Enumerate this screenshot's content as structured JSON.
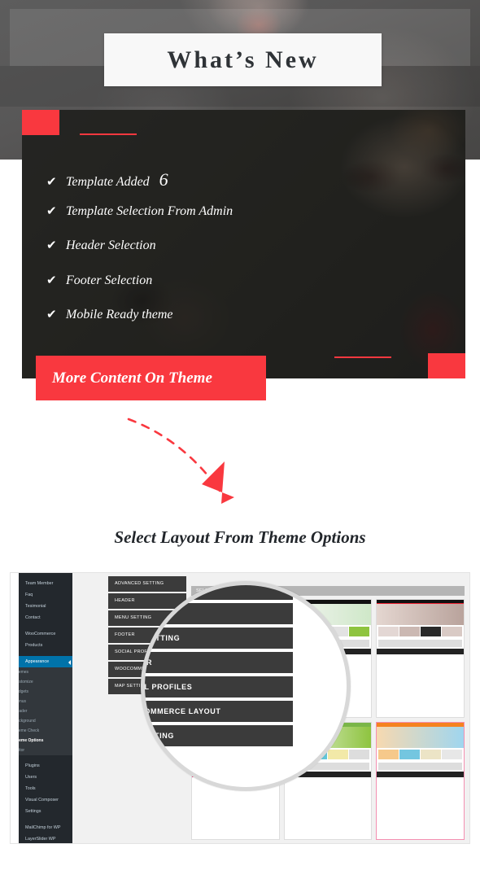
{
  "hero": {
    "title": "What’s New"
  },
  "feature_panel": {
    "items": [
      {
        "label": "Template Added",
        "count": "6"
      },
      {
        "label": "Template Selection From Admin",
        "count": ""
      },
      {
        "label": "Header Selection",
        "count": ""
      },
      {
        "label": "Footer Selection",
        "count": ""
      },
      {
        "label": "Mobile Ready theme",
        "count": ""
      }
    ],
    "check_icon": "✔",
    "accent_color": "#f9383f"
  },
  "cta": {
    "label": "More Content On Theme"
  },
  "section": {
    "heading": "Select Layout From Theme Options"
  },
  "screenshot": {
    "wp_sidebar": {
      "items": [
        {
          "label": "Team Member",
          "active": false
        },
        {
          "label": "Faq",
          "active": false
        },
        {
          "label": "Tesimonial",
          "active": false
        },
        {
          "label": "Contact",
          "active": false
        },
        {
          "label": "WooCommerce",
          "active": false
        },
        {
          "label": "Products",
          "active": false
        },
        {
          "label": "Appearance",
          "active": true
        }
      ],
      "submenu": [
        {
          "label": "Themes",
          "current": false
        },
        {
          "label": "Customize",
          "current": false
        },
        {
          "label": "Widgets",
          "current": false
        },
        {
          "label": "Menus",
          "current": false
        },
        {
          "label": "Header",
          "current": false
        },
        {
          "label": "Background",
          "current": false
        },
        {
          "label": "Theme Check",
          "current": false
        },
        {
          "label": "Theme Options",
          "current": true
        },
        {
          "label": "Editor",
          "current": false
        }
      ],
      "items_bottom": [
        {
          "label": "Plugins"
        },
        {
          "label": "Users"
        },
        {
          "label": "Tools"
        },
        {
          "label": "Visual Composer"
        },
        {
          "label": "Settings"
        },
        {
          "label": "MailChimp for WP"
        },
        {
          "label": "LayerSlider WP"
        }
      ]
    },
    "option_rows": [
      "ADVANCED SETTING",
      "HEADER",
      "MENU SETTING",
      "FOOTER",
      "SOCIAL PROFILES",
      "WOOCOMMERCE LAYOUT",
      "MAP SETTING"
    ],
    "magnified_rows": [
      "ADVANCED SETTING",
      "HEADER",
      "MENU SETTING",
      "FOOTER",
      "SOCIAL PROFILES",
      "WOOCOMMERCE LAYOUT",
      "MAP SETTING"
    ],
    "layout_header": "SELECT THEME LAYOUT",
    "thumbnails": [
      {
        "name": "theme-layout-1",
        "selected": false
      },
      {
        "name": "theme-layout-2",
        "selected": false
      },
      {
        "name": "theme-layout-3",
        "selected": false
      },
      {
        "name": "theme-layout-4",
        "selected": false
      },
      {
        "name": "theme-layout-5",
        "selected": false
      },
      {
        "name": "theme-layout-6",
        "selected": true
      }
    ]
  }
}
